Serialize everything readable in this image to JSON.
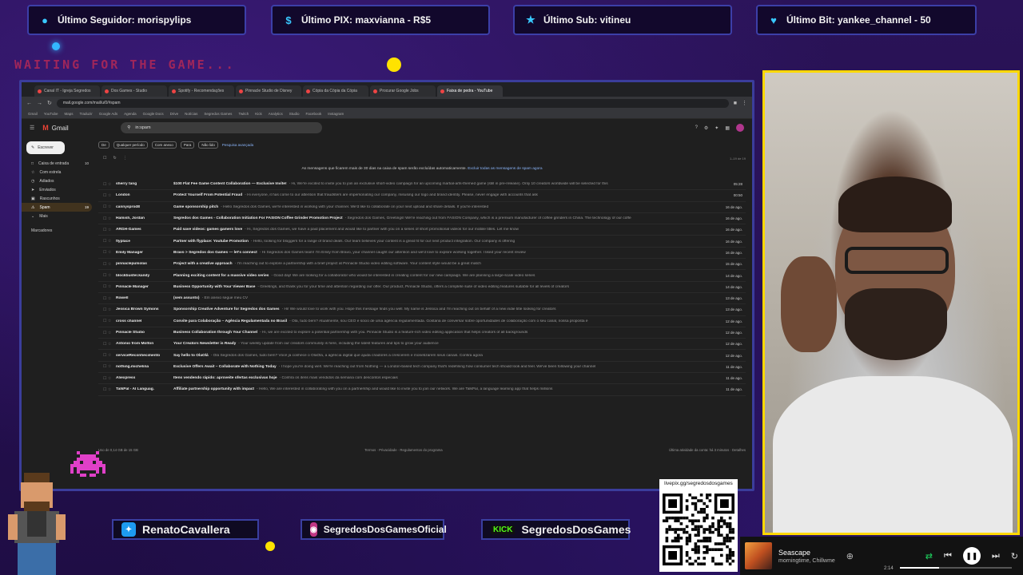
{
  "alerts": [
    {
      "icon": "person-icon",
      "label": "Último Seguidor: morispylips"
    },
    {
      "icon": "dollar-icon",
      "label": "Último PIX: maxvianna - R$5"
    },
    {
      "icon": "star-icon",
      "label": "Último Sub: vitineu"
    },
    {
      "icon": "heart-icon",
      "label": "Último Bit: yankee_channel - 50"
    }
  ],
  "waiting_text": "WAITING FOR THE GAME...",
  "browser": {
    "tabs": [
      "Canal IT - Igreja Segredos",
      "Dos Games - Studio",
      "Spotify - Recomendações",
      "Pinnacle Studio de Disney",
      "Cópia da Cópia da Cópia",
      "Procurar Google Jobs",
      "Faixa de pedra - YouTube"
    ],
    "url": "mail.google.com/mail/u/0/#spam",
    "bookmarks": [
      "Gmail",
      "YouTube",
      "Maps",
      "Traduzir",
      "Google Ads",
      "Agenda",
      "Google Docs",
      "Drive",
      "Notícias",
      "Segredos Games",
      "Twitch",
      "Kick",
      "Analytics",
      "Studio",
      "Facebook",
      "Instagram"
    ]
  },
  "gmail": {
    "brand": "Gmail",
    "search_value": "in:spam",
    "compose_label": "Escrever",
    "sidebar": [
      {
        "label": "Caixa de entrada",
        "count": "10",
        "active": false
      },
      {
        "label": "Com estrela",
        "count": "",
        "active": false
      },
      {
        "label": "Adiados",
        "count": "",
        "active": false
      },
      {
        "label": "Enviados",
        "count": "",
        "active": false
      },
      {
        "label": "Rascunhos",
        "count": "",
        "active": false
      },
      {
        "label": "Spam",
        "count": "19",
        "active": true
      },
      {
        "label": "Mais",
        "count": "",
        "active": false
      }
    ],
    "labels_heading": "Marcadores",
    "filters": [
      "De",
      "Qualquer período",
      "Com anexo",
      "Para",
      "Não lido"
    ],
    "advanced_search": "Pesquisa avançada",
    "pager": "1–19 de 19",
    "spam_notice": "As mensagens que ficarem mais de 30 dias na caixa de spam serão excluídas automaticamente.",
    "spam_notice_link": "Excluir todas as mensagens de spam agora",
    "emails": [
      {
        "from": "sherry tang",
        "subject": "$100 Flat Fee Game Content Collaboration — Exclusive Invite!",
        "snippet": "- Hi, We're excited to invite you to join an exclusive short-video campaign for an upcoming martial-arts-themed game (still in pre-release). Only 10 creators worldwide will be selected for this",
        "date": "05:28"
      },
      {
        "from": "London",
        "subject": "Protect Yourself From Potential Fraud",
        "snippet": "- Hi everyone, it has come to our attention that fraudsters are impersonating our company, misusing our logo and brand identity. Please, never engage with accounts that ask",
        "date": "00:50"
      },
      {
        "from": "cannysprod8",
        "subject": "Game sponsorship pitch",
        "snippet": "- Hello Segredos dos Games, we're interested in working with your channel. We'd like to collaborate on your next upload and share details. If you're interested",
        "date": "16 de ago."
      },
      {
        "from": "Hamish, Jordan",
        "subject": "Segredos dos Games - Collaboration Initiation For FASION Coffee Grinder Promotion Project",
        "snippet": "- Segredos dos Games, Greetings! We're reaching out from FASION Company, which is a premium manufacturer of coffee grinders in China. The technology of our coffe",
        "date": "16 de ago."
      },
      {
        "from": "ARGH-Games",
        "subject": "Paid save videos: games gamers love",
        "snippet": "- Hi, Segredos dos Games, we have a paid placement and would like to partner with you on a series of short promotional videos for our mobile titles. Let me know",
        "date": "16 de ago."
      },
      {
        "from": "flyplace",
        "subject": "Partner with flyplace: Youtube Promotion",
        "snippet": "- Hello, looking for bloggers for a range of brand deals. Our team believes your content is a great fit for our next product integration. Our company is offering",
        "date": "16 de ago."
      },
      {
        "from": "Emily Manager",
        "subject": "Bravo > Segredos dos Games — let's connect",
        "snippet": "- Hi Segredos dos Games team! I'm Emily from Bravo, your channel caught our attention and we'd love to explore working together. I liked your recent review",
        "date": "16 de ago."
      },
      {
        "from": "pinnaclepulsolas",
        "subject": "Project with a creative approach",
        "snippet": "- I'm reaching out to explore a partnership with a brief project at Pinnacle Studio video editing software. Your content style would be a great match",
        "date": "15 de ago."
      },
      {
        "from": "blockbuster.kandy",
        "subject": "Planning exciting content for a massive video series",
        "snippet": "- Good day! We are looking for a collaborator who would be interested in creating content for our new campaign. We are planning a large-scale video series",
        "date": "14 de ago."
      },
      {
        "from": "Pinnacle Manager",
        "subject": "Business Opportunity with Your Viewer Base",
        "snippet": "- Greetings, and thank you for your time and attention regarding our offer. Our product, Pinnacle Studio, offers a complete suite of video editing features suitable for all levels of creators",
        "date": "14 de ago."
      },
      {
        "from": "Rowell",
        "subject": "(sem assunto)",
        "snippet": "- Em anexo segue meu CV",
        "date": "13 de ago."
      },
      {
        "from": "Jessica Brown Symons",
        "subject": "Sponsorship Creative Adventure for Segredos dos Games",
        "snippet": "- Hi! We would love to work with you. Hope this message finds you well. My name is Jessica and I'm reaching out on behalf of a new indie title looking for creators",
        "date": "13 de ago."
      },
      {
        "from": "cross channel",
        "subject": "Convite para Colaboração – Agência Regulamentada no Brasil",
        "snippet": "- Olá, tudo bem? Atualmente, sou CEO e sócio de uma agência regulamentada. Gostaria de conversar sobre oportunidades de colaboração com o seu canal, nossa proposta é",
        "date": "12 de ago."
      },
      {
        "from": "Pinnacle Studio",
        "subject": "Business Collaboration through Your Channel",
        "snippet": "- Hi, we are excited to explore a potential partnership with you. Pinnacle Studio is a feature-rich video editing application that helps creators of all backgrounds",
        "date": "12 de ago."
      },
      {
        "from": "Antonio from Molton",
        "subject": "Your Creators Newsletter is Ready",
        "snippet": "- Your weekly update from our creators community is here, including the latest features and tips to grow your audience",
        "date": "12 de ago."
      },
      {
        "from": "serviceReconhecimento",
        "subject": "Say hello to OlaOlá",
        "snippet": "- Olá Segredos dos Games, tudo bem? Você já conhece o OlaOlá, a agência digital que ajuda criadores a crescerem e monetizarem seus canais. Confira agora",
        "date": "12 de ago."
      },
      {
        "from": "nothing.michelina",
        "subject": "Exclusive Offers Await – Collaborate with Nothing Today",
        "snippet": "- I hope you're doing well. We're reaching out from Nothing — a London-based tech company that's redefining how consumer tech should look and feel. We've been following your channel",
        "date": "11 de ago."
      },
      {
        "from": "Aliexpress",
        "subject": "Itens vendendo rápido: aproveite ofertas exclusivas hoje",
        "snippet": "- Confira os itens mais vendidos da semana com descontos especiais",
        "date": "11 de ago."
      },
      {
        "from": "TalkPal - AI Languag.",
        "subject": "Affiliate partnership opportunity with impact",
        "snippet": "- Hello, We are interested in collaborating with you on a partnership and would like to invite you to join our network. We are TalkPal, a language learning app that helps millions",
        "date": "11 de ago."
      }
    ],
    "footer_left": "Uso de 0,14 GB de 15 GB",
    "footer_center": "Termos · Privacidade · Regulamentos do programa",
    "footer_right": "Última atividade da conta: há 3 minutos · Detalhes"
  },
  "social": [
    {
      "icon": "twitter-icon",
      "handle": "RenatoCavallera"
    },
    {
      "icon": "instagram-icon",
      "handle": "SegredosDosGamesOficial"
    },
    {
      "icon": "kick-icon",
      "tag": "KICK",
      "handle": "SegredosDosGames"
    }
  ],
  "qr_url": "livepix.gg/segredosdosgames",
  "player": {
    "title": "Seascape",
    "artist": "morningtime, Chillwme",
    "time": "2:14",
    "progress": 0.35
  },
  "colors": {
    "overlay_purple": "#23104a",
    "frame_blue": "#3b3d9c",
    "webcam_border": "#ffd800",
    "gmail_dark": "#1f1f1f",
    "spam_highlight": "#41331e",
    "kick_green": "#53fc18"
  }
}
